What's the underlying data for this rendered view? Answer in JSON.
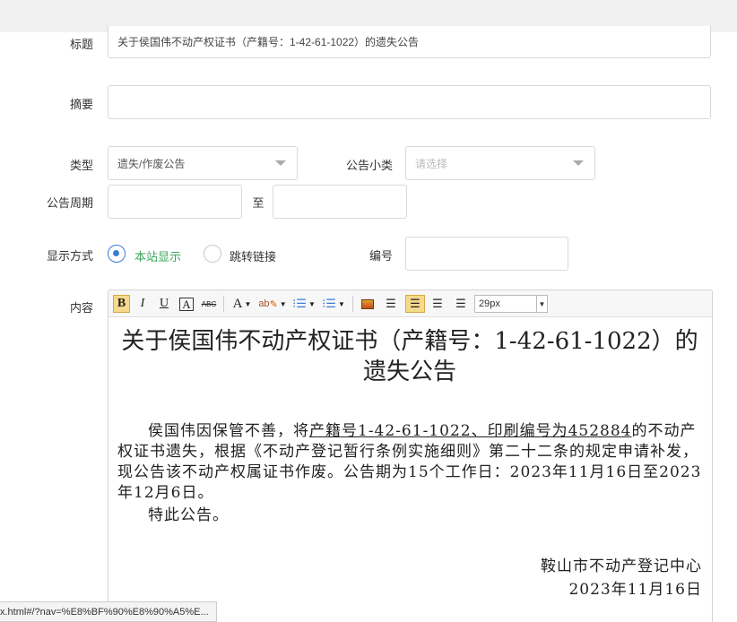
{
  "form": {
    "title_label": "标题",
    "title_value": "关于侯国伟不动产权证书（产籍号：1-42-61-1022）的遗失公告",
    "summary_label": "摘要",
    "summary_value": "",
    "type_label": "类型",
    "type_value": "遗失/作废公告",
    "subtype_label": "公告小类",
    "subtype_placeholder": "请选择",
    "period_label": "公告周期",
    "period_sep": "至",
    "period_start": "",
    "period_end": "",
    "display_label": "显示方式",
    "display_options": [
      "本站显示",
      "跳转链接"
    ],
    "display_selected": "本站显示",
    "number_label": "编号",
    "number_value": "",
    "content_label": "内容"
  },
  "toolbar": {
    "bold": "B",
    "italic": "I",
    "underline": "U",
    "border": "A",
    "strike": "ABC",
    "fontcolor": "A",
    "highlight": "ab",
    "font_size": "29px"
  },
  "document": {
    "title": "关于侯国伟不动产权证书（产籍号：1-42-61-1022）的遗失公告",
    "para_start": "侯国伟因保管不善，将",
    "para_underlined": "产籍号1-42-61-1022、印刷编号为452884",
    "para_end": "的不动产权证书遗失，根据《不动产登记暂行条例实施细则》第二十二条的规定申请补发，现公告该不动产权属证书作废。公告期为15个工作日：2023年11月16日至2023年12月6日。",
    "closing": "特此公告。",
    "signature": "鞍山市不动产登记中心",
    "date": "2023年11月16日"
  },
  "status_url": "x.html#/?nav=%E8%BF%90%E8%90%A5%E..."
}
